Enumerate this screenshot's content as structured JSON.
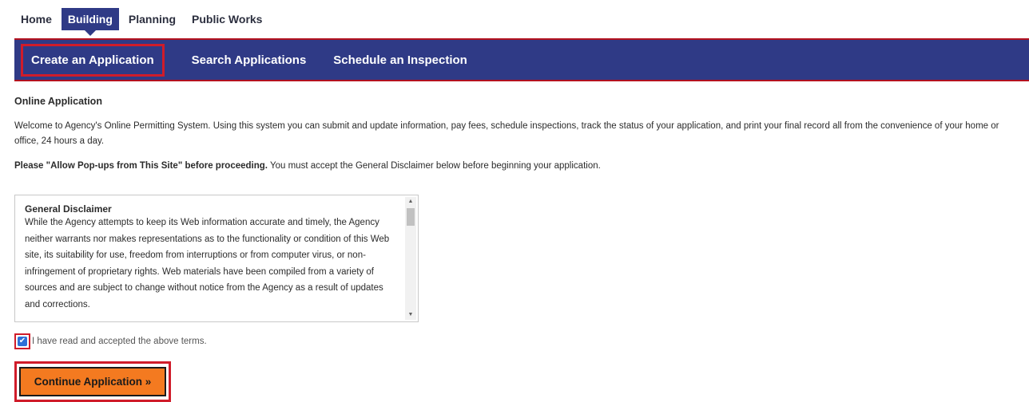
{
  "top_nav": {
    "tabs": [
      {
        "label": "Home"
      },
      {
        "label": "Building"
      },
      {
        "label": "Planning"
      },
      {
        "label": "Public Works"
      }
    ],
    "active": "Building"
  },
  "sub_nav": {
    "items": [
      {
        "label": "Create an Application"
      },
      {
        "label": "Search Applications"
      },
      {
        "label": "Schedule an Inspection"
      }
    ]
  },
  "main": {
    "title": "Online Application",
    "intro": "Welcome to Agency's Online Permitting System. Using this system you can submit and update information, pay fees, schedule inspections, track the status of your application, and print your final record all from the convenience of your home or office, 24 hours a day.",
    "popup_bold": "Please \"Allow Pop-ups from This Site\" before proceeding.",
    "popup_rest": " You must accept the General Disclaimer below before beginning your application.",
    "disclaimer": {
      "title": "General Disclaimer",
      "text": "While the Agency attempts to keep its Web information accurate and timely, the Agency neither warrants nor makes representations as to the functionality or condition of this Web site, its suitability for use, freedom from interruptions or from computer virus, or non-infringement of proprietary rights. Web materials have been compiled from a variety of sources and are subject to change without notice from the Agency as a result of updates and corrections."
    },
    "accept": {
      "label": "I have read and accepted the above terms.",
      "checked": true
    },
    "continue_label": "Continue Application »"
  },
  "icons": {
    "check": "checkmark-icon",
    "scroll_up": "scroll-up-icon",
    "scroll_down": "scroll-down-icon"
  },
  "colors": {
    "nav_blue": "#2f3a86",
    "highlight_red": "#d01c2a",
    "button_orange": "#f47a20",
    "checkbox_blue": "#2e6fd6"
  }
}
